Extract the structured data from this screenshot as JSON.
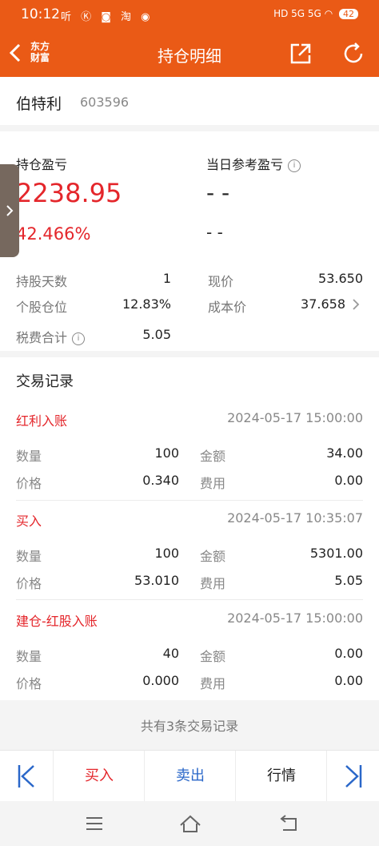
{
  "status": {
    "time": "10:12",
    "apps": "听 Ⓚ ◙ 淘 ◉",
    "network": "HD 5G 5G",
    "battery": "42"
  },
  "header": {
    "logo_line1": "东方",
    "logo_line2": "财富",
    "title": "持仓明细"
  },
  "stock": {
    "name": "伯特利",
    "code": "603596"
  },
  "summary": {
    "pnl_label": "持仓盈亏",
    "pnl_value": "2238.95",
    "pnl_pct": "42.466%",
    "day_label": "当日参考盈亏",
    "day_value": "- -",
    "day_pct": "- -",
    "hold_days_label": "持股天数",
    "hold_days": "1",
    "price_label": "现价",
    "price": "53.650",
    "position_label": "个股仓位",
    "position": "12.83%",
    "cost_label": "成本价",
    "cost": "37.658",
    "fee_label": "税费合计",
    "fee": "5.05"
  },
  "trades": {
    "section_title": "交易记录",
    "qty_label": "数量",
    "price_label": "价格",
    "amount_label": "金额",
    "fee_label": "费用",
    "records": [
      {
        "type": "红利入账",
        "datetime": "2024-05-17  15:00:00",
        "qty": "100",
        "price": "0.340",
        "amount": "34.00",
        "fee": "0.00"
      },
      {
        "type": "买入",
        "datetime": "2024-05-17  10:35:07",
        "qty": "100",
        "price": "53.010",
        "amount": "5301.00",
        "fee": "5.05"
      },
      {
        "type": "建仓-红股入账",
        "datetime": "2024-05-17  15:00:00",
        "qty": "40",
        "price": "0.000",
        "amount": "0.00",
        "fee": "0.00"
      }
    ],
    "footer": "共有3条交易记录"
  },
  "tabbar": {
    "buy": "买入",
    "sell": "卖出",
    "quote": "行情"
  },
  "colors": {
    "brand": "#ea5a16",
    "red": "#e4262b",
    "blue": "#2a67c9"
  }
}
